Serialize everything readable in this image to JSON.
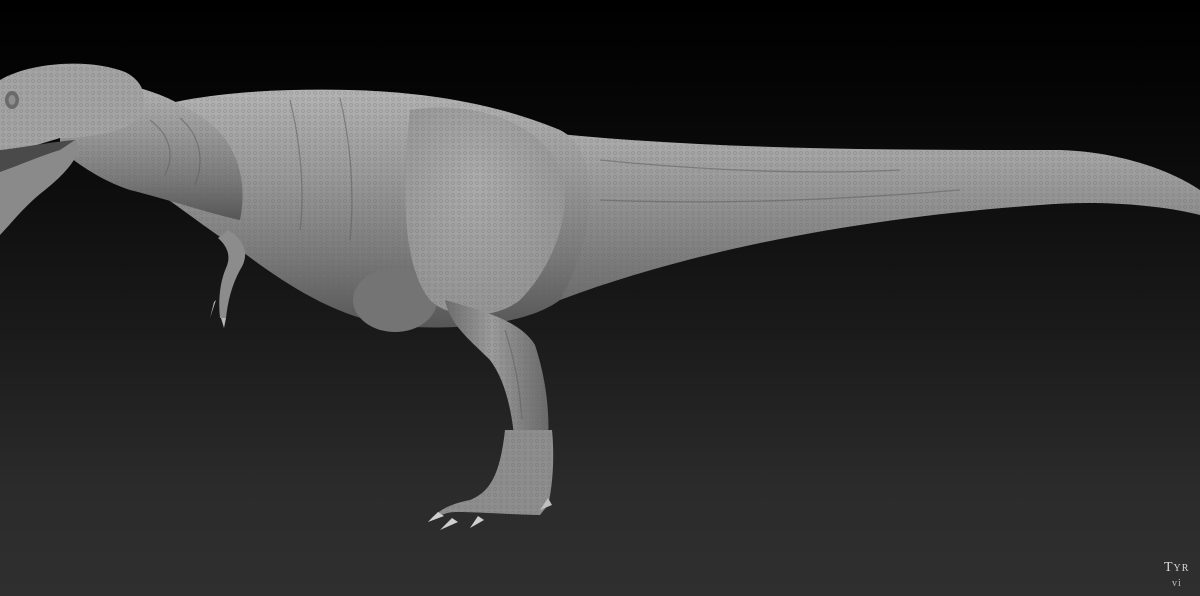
{
  "scene": {
    "subject": "tyrannosaurus-sculpt",
    "background_top_color": "#000000",
    "background_bottom_color": "#2f2f2f",
    "model_color": "#8f8f8f"
  },
  "caption": {
    "line1": "Tyr",
    "line2": "vi"
  }
}
